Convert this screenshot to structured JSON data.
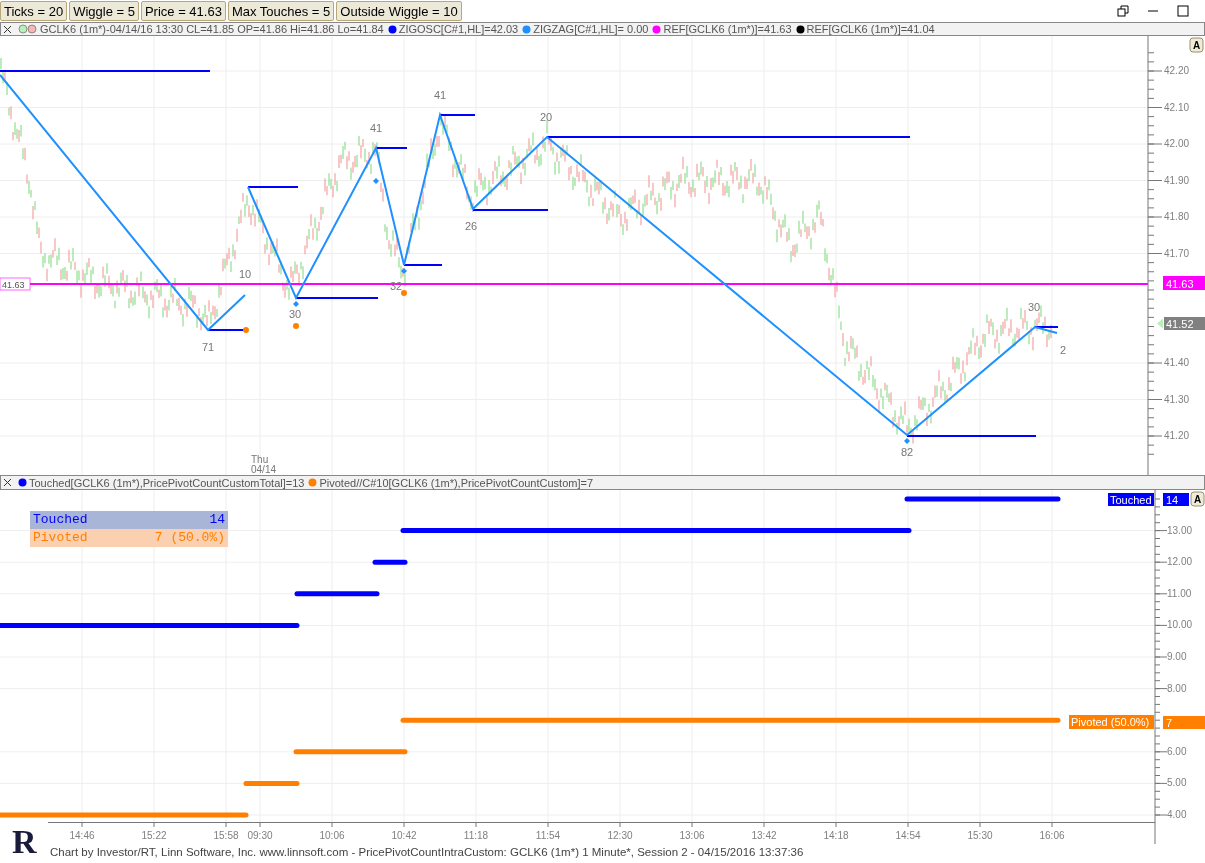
{
  "params": [
    "Ticks = 20",
    "Wiggle = 5",
    "Price = 41.63",
    "Max Touches = 5",
    "Outside Wiggle = 10"
  ],
  "price_pane": {
    "legend": [
      {
        "kind": "bars",
        "text": "GCLK6 (1m*)-04/14/16 13:30 CL=41.85 OP=41.86 Hi=41.86 Lo=41.84"
      },
      {
        "kind": "dot",
        "color": "#0000ff",
        "text": "ZIGOSC[C#1,HL]=42.03"
      },
      {
        "kind": "dot",
        "color": "#1e90ff",
        "text": "ZIGZAG[C#1,HL]= 0.00"
      },
      {
        "kind": "dot",
        "color": "#ff00ff",
        "text": "REF[GCLK6 (1m*)]=41.63"
      },
      {
        "kind": "dot",
        "color": "#000000",
        "text": "REF[GCLK6 (1m*)]=41.04"
      }
    ],
    "y_ticks": [
      "42.20",
      "42.10",
      "42.00",
      "41.90",
      "41.80",
      "41.70",
      "41.40",
      "41.30",
      "41.20"
    ],
    "pivot_labels": [
      "71",
      "10",
      "30",
      "41",
      "32",
      "41",
      "26",
      "20",
      "82",
      "30",
      "2"
    ],
    "ref_tag": "41.63",
    "ref_left_tag": "41.63",
    "last_price_tag": "41.52",
    "date_label": [
      "Thu",
      "04/14"
    ],
    "autoscale": "A"
  },
  "count_pane": {
    "legend": [
      {
        "color": "#0000ff",
        "text": "Touched[GCLK6 (1m*),PricePivotCountCustomTotal]=13"
      },
      {
        "color": "#ff8000",
        "text": "Pivoted//C#10[GCLK6 (1m*),PricePivotCountCustom]=7"
      }
    ],
    "summary": [
      {
        "label": "Touched",
        "value": "14"
      },
      {
        "label": "Pivoted",
        "value": "7 (50.0%)"
      }
    ],
    "series_tags": [
      {
        "label": "Touched",
        "value": "14",
        "color": "#0000ff"
      },
      {
        "label": "Pivoted (50.0%)",
        "value": "7",
        "color": "#ff8000"
      }
    ],
    "y_ticks": [
      "13.00",
      "12.00",
      "11.00",
      "10.00",
      "9.00",
      "8.00",
      "6.00",
      "5.00",
      "4.00"
    ],
    "autoscale": "A"
  },
  "x_ticks": [
    "14:46",
    "15:22",
    "15:58",
    "09:30",
    "10:06",
    "10:42",
    "11:18",
    "11:54",
    "12:30",
    "13:06",
    "13:42",
    "14:18",
    "14:54",
    "15:30",
    "16:06"
  ],
  "logo_letter": "R",
  "footer": "Chart by Investor/RT, Linn Software, Inc. www.linnsoft.com - PricePivotCountIntraCustom: GCLK6 (1m*) 1 Minute*, Session 2 - 04/15/2016 13:37:36"
}
